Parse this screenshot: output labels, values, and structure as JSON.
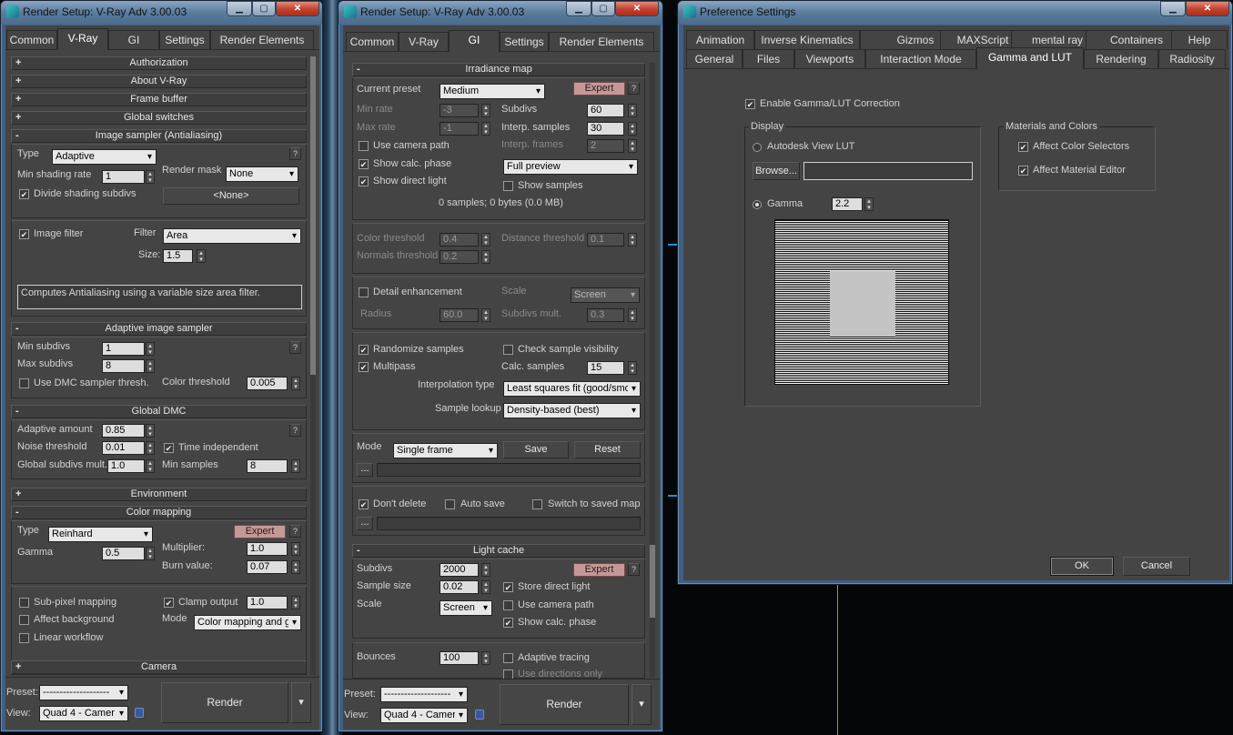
{
  "w1": {
    "title": "Render Setup: V-Ray Adv 3.00.03",
    "tabs": [
      "Common",
      "V-Ray",
      "GI",
      "Settings",
      "Render Elements"
    ],
    "r": {
      "auth": "Authorization",
      "about": "About V-Ray",
      "fb": "Frame buffer",
      "gs": "Global switches",
      "is": "Image sampler (Antialiasing)",
      "ais": "Adaptive image sampler",
      "gdmc": "Global DMC",
      "env": "Environment",
      "cm": "Color mapping",
      "cam": "Camera"
    },
    "is": {
      "type_l": "Type",
      "type_v": "Adaptive",
      "msr_l": "Min shading rate",
      "msr_v": "1",
      "rm_l": "Render mask",
      "rm_v": "None",
      "dss": "Divide shading subdivs",
      "none": "<None>",
      "if": "Image filter",
      "filt_l": "Filter",
      "filt_v": "Area",
      "size_l": "Size:",
      "size_v": "1.5",
      "desc": "Computes Antialiasing using a variable size area filter."
    },
    "ais": {
      "mins_l": "Min subdivs",
      "mins_v": "1",
      "maxs_l": "Max subdivs",
      "maxs_v": "8",
      "udmc": "Use DMC sampler thresh.",
      "ct_l": "Color threshold",
      "ct_v": "0.005"
    },
    "g": {
      "aa_l": "Adaptive amount",
      "aa_v": "0.85",
      "nt_l": "Noise threshold",
      "nt_v": "0.01",
      "ti": "Time independent",
      "gsm_l": "Global subdivs mult.",
      "gsm_v": "1.0",
      "ms_l": "Min samples",
      "ms_v": "8"
    },
    "cm": {
      "type_l": "Type",
      "type_v": "Reinhard",
      "expert": "Expert",
      "gamma_l": "Gamma",
      "gamma_v": "0.5",
      "mult_l": "Multiplier:",
      "mult_v": "1.0",
      "burn_l": "Burn value:",
      "burn_v": "0.07",
      "spm": "Sub-pixel mapping",
      "clamp": "Clamp output",
      "clamp_v": "1.0",
      "ab": "Affect background",
      "mode_l": "Mode",
      "mode_v": "Color mapping and g",
      "lw": "Linear workflow"
    },
    "preset_l": "Preset:",
    "preset_v": "--------------------",
    "view_l": "View:",
    "view_v": "Quad 4 - Camer",
    "render": "Render"
  },
  "w2": {
    "title": "Render Setup: V-Ray Adv 3.00.03",
    "tabs": [
      "Common",
      "V-Ray",
      "GI",
      "Settings",
      "Render Elements"
    ],
    "im": {
      "hdr": "Irradiance map",
      "cp_l": "Current preset",
      "cp_v": "Medium",
      "expert": "Expert",
      "minr_l": "Min rate",
      "minr_v": "-3",
      "sub_l": "Subdivs",
      "sub_v": "60",
      "maxr_l": "Max rate",
      "maxr_v": "-1",
      "is_l": "Interp. samples",
      "is_v": "30",
      "ucp": "Use camera path",
      "if_l": "Interp. frames",
      "if_v": "2",
      "scp": "Show calc. phase",
      "fp_v": "Full preview",
      "sdl": "Show direct light",
      "ss": "Show samples",
      "samples": "0 samples; 0 bytes (0.0 MB)",
      "cth_l": "Color threshold",
      "cth_v": "0.4",
      "dth_l": "Distance threshold",
      "dth_v": "0.1",
      "nth_l": "Normals threshold",
      "nth_v": "0.2",
      "de": "Detail enhancement",
      "sc_l": "Scale",
      "sc_v": "Screen",
      "rad_l": "Radius",
      "rad_v": "60.0",
      "sm_l": "Subdivs mult.",
      "sm_v": "0.3",
      "rs": "Randomize samples",
      "csv": "Check sample visibility",
      "mp": "Multipass",
      "cs_l": "Calc. samples",
      "cs_v": "15",
      "it_l": "Interpolation type",
      "it_v": "Least squares fit (good/smo",
      "sl_l": "Sample lookup",
      "sl_v": "Density-based (best)",
      "mode_l": "Mode",
      "mode_v": "Single frame",
      "save": "Save",
      "reset": "Reset",
      "dots": "...",
      "dd": "Don't delete",
      "as": "Auto save",
      "stsm": "Switch to saved map"
    },
    "lc": {
      "hdr": "Light cache",
      "sub_l": "Subdivs",
      "sub_v": "2000",
      "expert": "Expert",
      "ss_l": "Sample size",
      "ss_v": "0.02",
      "sdl": "Store direct light",
      "sc_l": "Scale",
      "sc_v": "Screen",
      "ucp": "Use camera path",
      "scp": "Show calc. phase",
      "b_l": "Bounces",
      "b_v": "100",
      "at": "Adaptive tracing",
      "udo": "Use directions only"
    },
    "preset_l": "Preset:",
    "preset_v": "--------------------",
    "view_l": "View:",
    "view_v": "Quad 4 - Camer",
    "render": "Render"
  },
  "w3": {
    "title": "Preference Settings",
    "tabs1": [
      "Animation",
      "Inverse Kinematics",
      "Gizmos",
      "MAXScript",
      "mental ray",
      "Containers",
      "Help"
    ],
    "tabs2": [
      "General",
      "Files",
      "Viewports",
      "Interaction Mode",
      "Gamma and LUT",
      "Rendering",
      "Radiosity"
    ],
    "egl": "Enable Gamma/LUT Correction",
    "disp": "Display",
    "lut": "Autodesk View LUT",
    "browse": "Browse...",
    "gamma": "Gamma",
    "gamma_v": "2.2",
    "mc": "Materials and Colors",
    "acs": "Affect Color Selectors",
    "ame": "Affect Material Editor",
    "ok": "OK",
    "cancel": "Cancel"
  },
  "icons": {
    "check": "✔",
    "up": "▴",
    "down": "▾",
    "q": "?",
    "plus": "+",
    "minus": "-",
    "min": "▁",
    "max": "▢",
    "close": "✕"
  }
}
